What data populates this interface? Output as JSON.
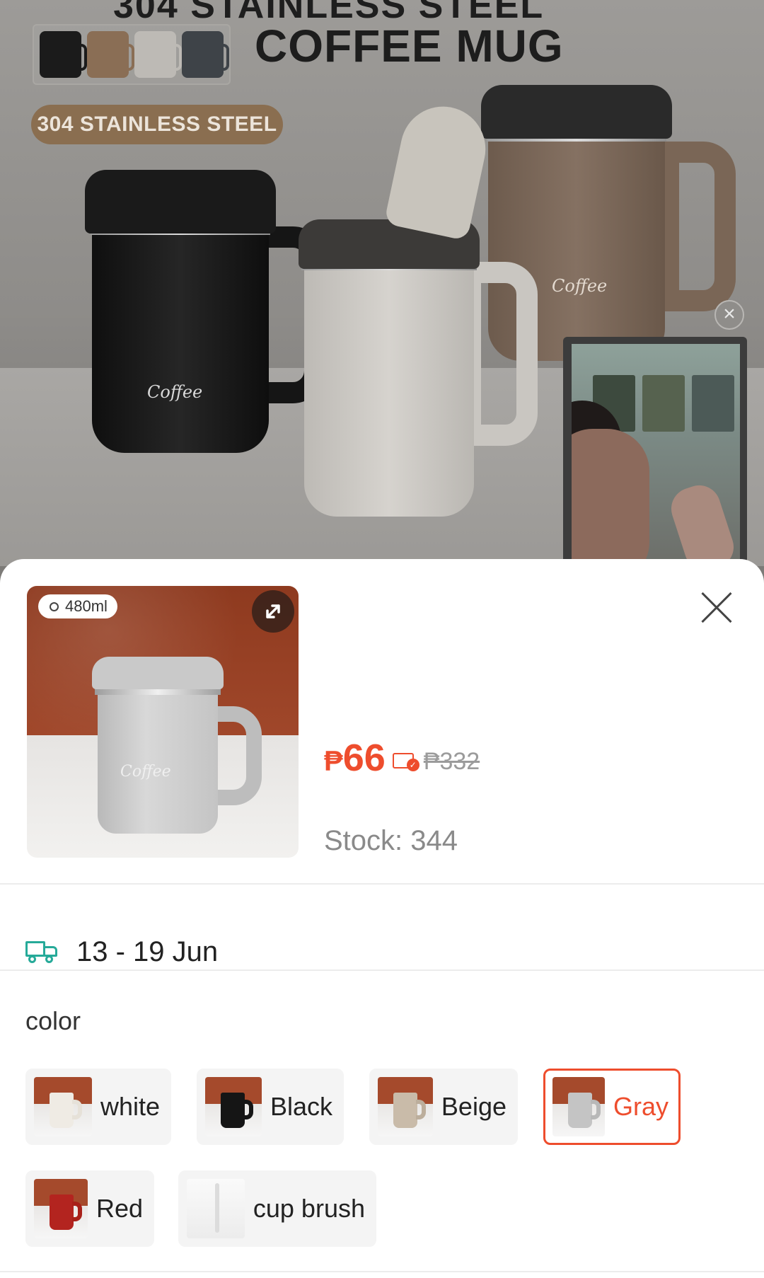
{
  "banner": {
    "top_text_partial": "304 STAINLESS STEEL",
    "headline": "COFFEE MUG",
    "material_pill": "304 STAINLESS STEEL",
    "mug_logo": "Coffee"
  },
  "popup": {
    "size_badge": "480ml",
    "mug_logo": "Coffee",
    "price_currency": "₱",
    "price_value": "66",
    "original_price": "₱332",
    "stock_text": "Stock: 344",
    "delivery_text": "13 - 19 Jun",
    "variation_label": "color",
    "options": [
      {
        "label": "white",
        "selected": false
      },
      {
        "label": "Black",
        "selected": false
      },
      {
        "label": "Beige",
        "selected": false
      },
      {
        "label": "Gray",
        "selected": true
      },
      {
        "label": "Red",
        "selected": false
      },
      {
        "label": "cup brush",
        "selected": false
      }
    ]
  },
  "colors": {
    "accent": "#ee4d2d",
    "delivery_icon": "#26aa99"
  },
  "icons": {
    "expand": "expand-icon",
    "close": "close-icon",
    "pip_close": "close-icon",
    "voucher": "voucher-check-icon",
    "delivery": "truck-icon"
  }
}
